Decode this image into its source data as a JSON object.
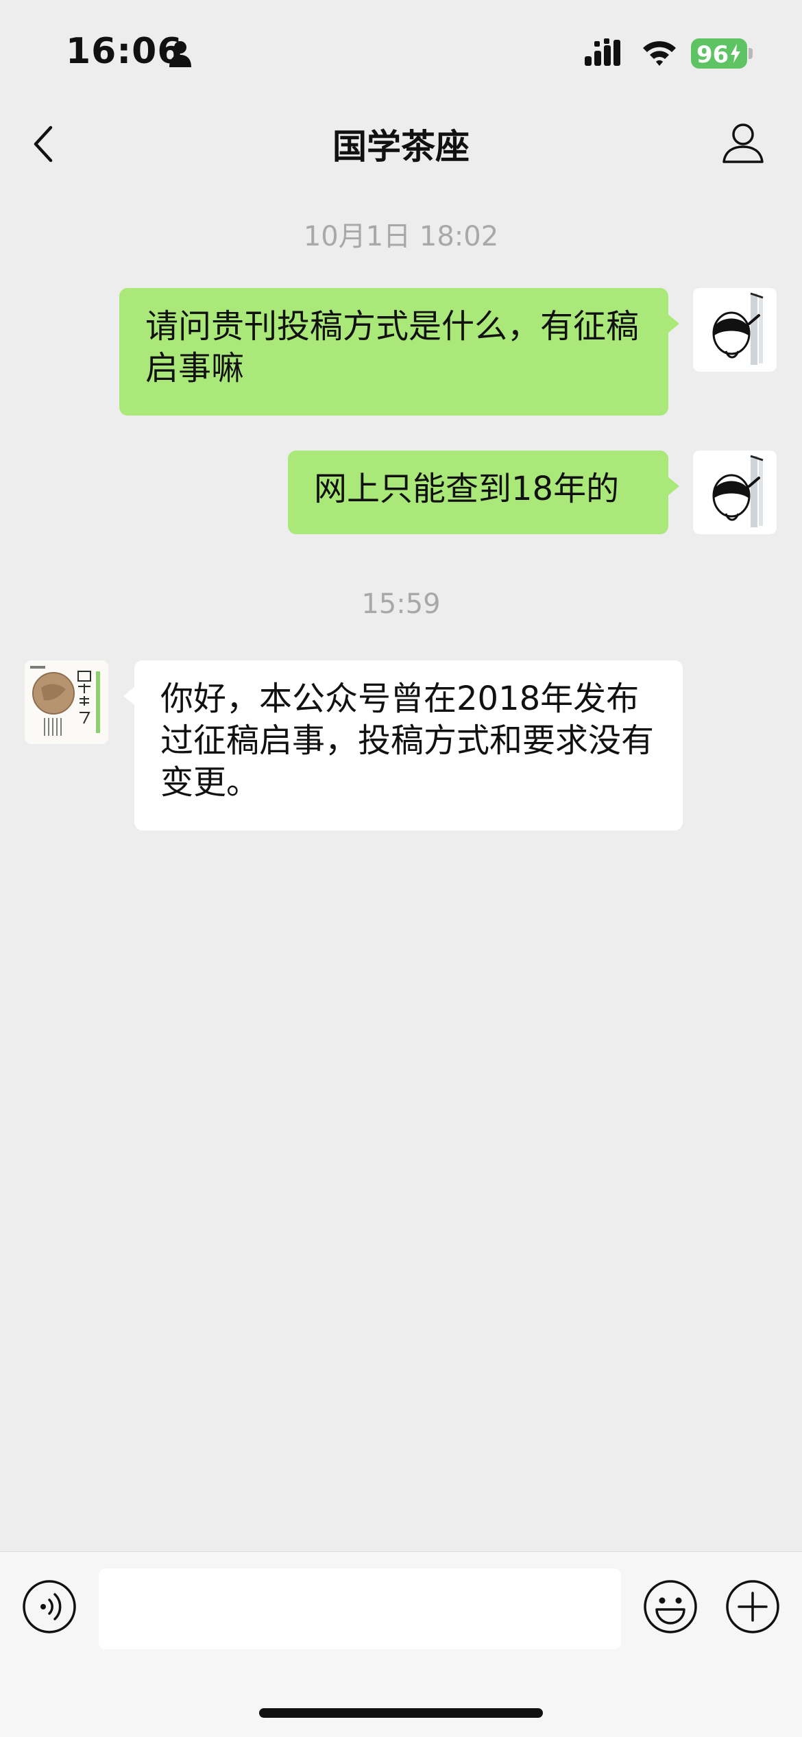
{
  "status_bar": {
    "time": "16:06",
    "battery": "96",
    "icons": [
      "person-icon",
      "signal-icon",
      "wifi-icon",
      "battery-charging-icon"
    ]
  },
  "nav": {
    "title": "国学茶座",
    "back_icon": "chevron-left-icon",
    "profile_icon": "person-outline-icon"
  },
  "chat": {
    "timestamps": [
      "10月1日 18:02",
      "15:59"
    ],
    "messages": [
      {
        "sender": "me",
        "text": "请问贵刊投稿方式是什么，有征稿启事嘛"
      },
      {
        "sender": "me",
        "text": "网上只能查到18年的"
      },
      {
        "sender": "other",
        "text": "你好，本公众号曾在2018年发布过征稿启事，投稿方式和要求没有变更。"
      }
    ]
  },
  "input_bar": {
    "value": "",
    "icons": [
      "voice-icon",
      "emoji-icon",
      "plus-icon"
    ]
  },
  "colors": {
    "background": "#ededed",
    "sent_bubble": "#a9e879",
    "received_bubble": "#ffffff",
    "battery": "#5ec363",
    "timestamp": "#a8a8a8"
  }
}
